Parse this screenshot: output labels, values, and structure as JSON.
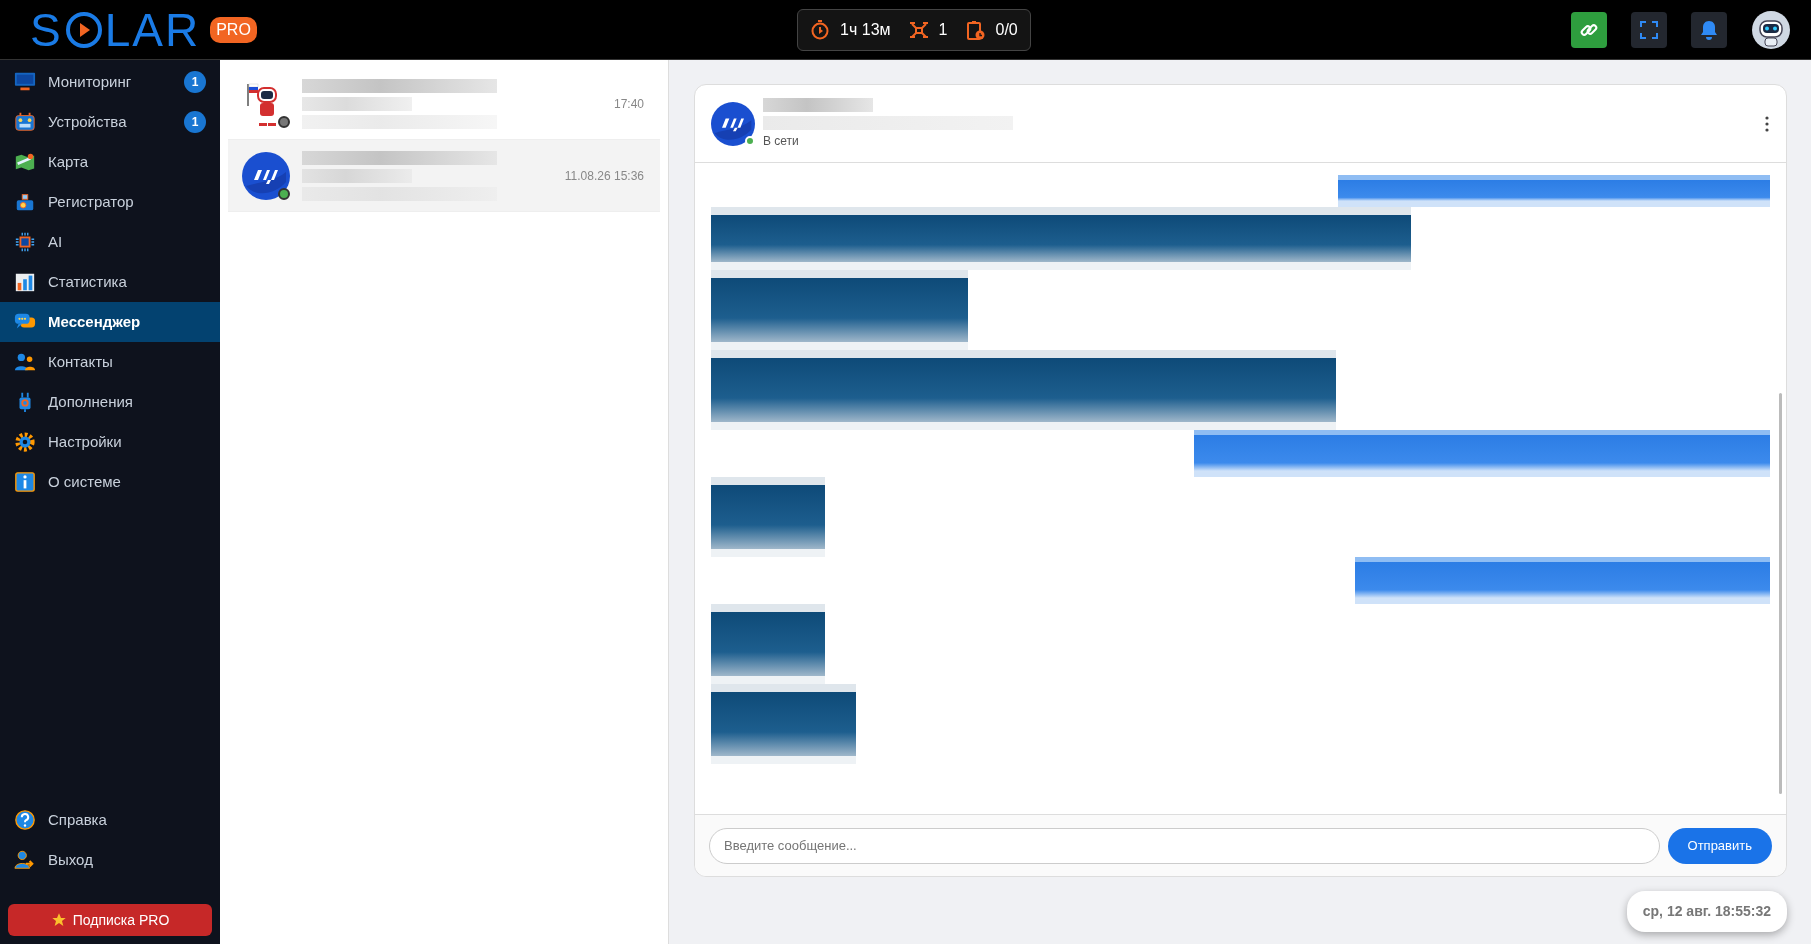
{
  "logo": {
    "text_start": "S",
    "text_end": "LAR",
    "badge": "PRO"
  },
  "stats": [
    {
      "kind": "timer",
      "value": "1ч 13м"
    },
    {
      "kind": "drone",
      "value": "1"
    },
    {
      "kind": "tasks",
      "value": "0/0"
    }
  ],
  "sidebar": {
    "items": [
      {
        "kind": "monitor",
        "label": "Мониторинг",
        "badge": "1",
        "selected": false
      },
      {
        "kind": "remote",
        "label": "Устройства",
        "badge": "1",
        "selected": false
      },
      {
        "kind": "map",
        "label": "Карта",
        "selected": false
      },
      {
        "kind": "dashcam",
        "label": "Регистратор",
        "selected": false
      },
      {
        "kind": "chip",
        "label": "AI",
        "selected": false
      },
      {
        "kind": "chart",
        "label": "Статистика",
        "selected": false
      },
      {
        "kind": "chat",
        "label": "Мессенджер",
        "selected": true
      },
      {
        "kind": "people",
        "label": "Контакты",
        "selected": false
      },
      {
        "kind": "plug",
        "label": "Дополнения",
        "selected": false
      },
      {
        "kind": "gear",
        "label": "Настройки",
        "selected": false
      },
      {
        "kind": "info",
        "label": "О системе",
        "selected": false
      }
    ],
    "bottom_items": [
      {
        "kind": "help",
        "label": "Справка"
      },
      {
        "kind": "logout",
        "label": "Выход"
      }
    ],
    "subscribe_button": "Подписка PRO"
  },
  "chats": [
    {
      "kind": "robot",
      "online": false,
      "selected": false,
      "time": "17:40"
    },
    {
      "kind": "brand",
      "online": true,
      "selected": true,
      "time": "11.08.26 15:36"
    }
  ],
  "conversation": {
    "status": "В сети",
    "online": true,
    "messages": [
      {
        "kind": "outgoing"
      },
      {
        "kind": "incoming"
      },
      {
        "kind": "incoming"
      },
      {
        "kind": "incoming"
      },
      {
        "kind": "outgoing"
      },
      {
        "kind": "incoming"
      },
      {
        "kind": "outgoing"
      },
      {
        "kind": "incoming"
      },
      {
        "kind": "incoming"
      }
    ],
    "input": {
      "placeholder": "Введите сообщение..."
    },
    "send_button": "Отправить"
  },
  "clock": "ср, 12 авг. 18:55:32"
}
